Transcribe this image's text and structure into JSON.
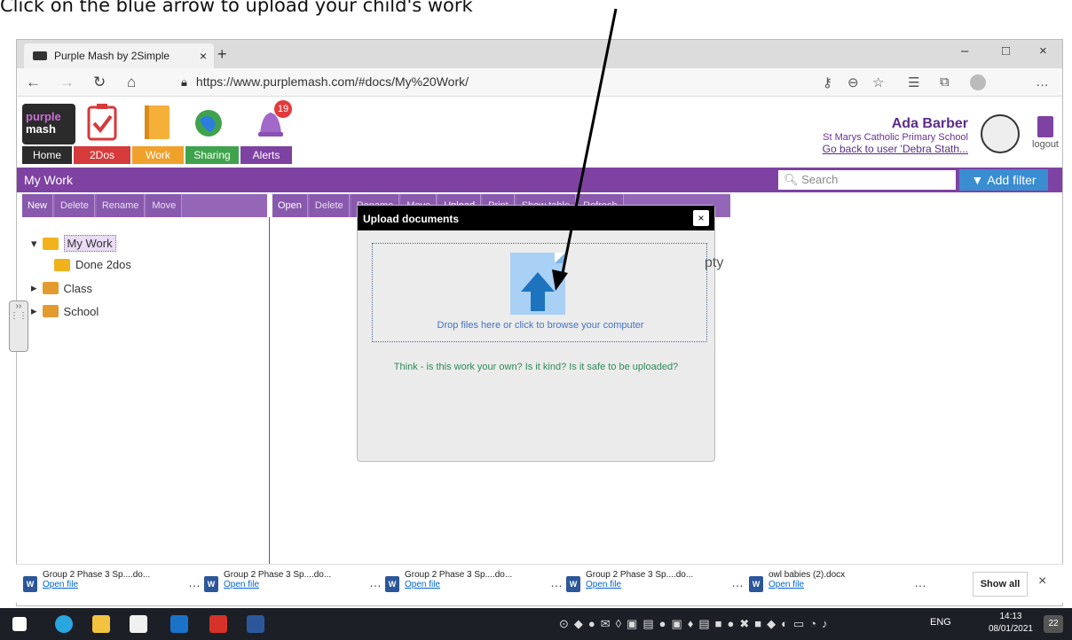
{
  "instruction": "Click on the blue arrow to upload your child's work",
  "browser": {
    "tab_title": "Purple Mash by 2Simple",
    "tab_close": "×",
    "new_tab": "+",
    "url": "https://www.purplemash.com/#docs/My%20Work/",
    "win_min": "–",
    "win_max": "□",
    "win_close": "×",
    "nav_back": "←",
    "nav_forward": "→",
    "nav_refresh": "↻",
    "nav_home": "⌂",
    "more": "…"
  },
  "app": {
    "logo_line1": "purple",
    "logo_line2": "mash",
    "nav": [
      "Home",
      "2Dos",
      "Work",
      "Sharing",
      "Alerts"
    ],
    "alerts_badge": "19",
    "user_name": "Ada Barber",
    "school": "St Marys Catholic Primary School",
    "go_back": "Go back to user 'Debra Stath...",
    "logout": "logout",
    "section_title": "My Work",
    "search_placeholder": "Search",
    "add_filter": "Add filter",
    "left_toolbar": [
      "New",
      "Delete",
      "Rename",
      "Move"
    ],
    "right_toolbar": [
      "Open",
      "Delete",
      "Rename",
      "Move",
      "Upload",
      "Print",
      "Show table",
      "Refresh"
    ],
    "tree": [
      "My Work",
      "Done 2dos",
      "Class",
      "School"
    ],
    "empty_text": "pty"
  },
  "modal": {
    "title": "Upload documents",
    "close": "×",
    "drop_text": "Drop files here or click to browse your computer",
    "think_text": "Think - is this work your own? Is it kind? Is it safe to be uploaded?"
  },
  "downloads": {
    "items": [
      {
        "name": "Group 2 Phase 3 Sp....do...",
        "open": "Open file"
      },
      {
        "name": "Group 2 Phase 3 Sp....do...",
        "open": "Open file"
      },
      {
        "name": "Group 2 Phase 3 Sp....do...",
        "open": "Open file"
      },
      {
        "name": "Group 2 Phase 3 Sp....do...",
        "open": "Open file"
      },
      {
        "name": "owl babies (2).docx",
        "open": "Open file"
      }
    ],
    "show_all": "Show all",
    "close": "×"
  },
  "taskbar": {
    "lang": "ENG",
    "time": "14:13",
    "date": "08/01/2021",
    "notif": "22"
  },
  "colors": {
    "purple": "#7e42a3",
    "blue": "#3a8dd1",
    "upload_blue": "#1e73be"
  }
}
